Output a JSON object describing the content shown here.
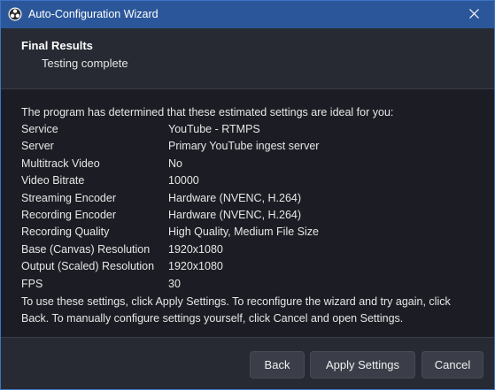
{
  "window": {
    "title": "Auto-Configuration Wizard",
    "app_icon": "obs-logo-icon",
    "close_icon": "close-icon"
  },
  "header": {
    "title": "Final Results",
    "subtitle": "Testing complete"
  },
  "content": {
    "intro": "The program has determined that these estimated settings are ideal for you:",
    "settings": [
      {
        "label": "Service",
        "value": "YouTube - RTMPS"
      },
      {
        "label": "Server",
        "value": "Primary YouTube ingest server"
      },
      {
        "label": "Multitrack Video",
        "value": "No"
      },
      {
        "label": "Video Bitrate",
        "value": "10000"
      },
      {
        "label": "Streaming Encoder",
        "value": "Hardware (NVENC, H.264)"
      },
      {
        "label": "Recording Encoder",
        "value": "Hardware (NVENC, H.264)"
      },
      {
        "label": "Recording Quality",
        "value": "High Quality, Medium File Size"
      },
      {
        "label": "Base (Canvas) Resolution",
        "value": "1920x1080"
      },
      {
        "label": "Output (Scaled) Resolution",
        "value": "1920x1080"
      },
      {
        "label": "FPS",
        "value": "30"
      }
    ],
    "outro": "To use these settings, click Apply Settings. To reconfigure the wizard and try again, click Back. To manually configure settings yourself, click Cancel and open Settings."
  },
  "buttons": {
    "back": "Back",
    "apply": "Apply Settings",
    "cancel": "Cancel"
  },
  "colors": {
    "titlebar": "#2b579a",
    "background": "#1c1d24",
    "panel": "#272a33",
    "button": "#3b3e48"
  }
}
